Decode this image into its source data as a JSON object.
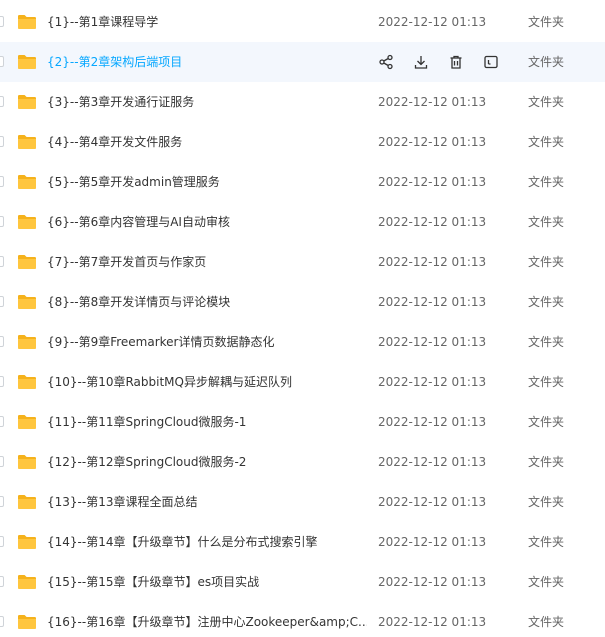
{
  "files": [
    {
      "name": "{1}--第1章课程导学",
      "date": "2022-12-12 01:13",
      "type": "文件夹"
    },
    {
      "name": "{2}--第2章架构后端项目",
      "date": "2022-12-12 01:13",
      "type": "文件夹",
      "hovered": true
    },
    {
      "name": "{3}--第3章开发通行证服务",
      "date": "2022-12-12 01:13",
      "type": "文件夹"
    },
    {
      "name": "{4}--第4章开发文件服务",
      "date": "2022-12-12 01:13",
      "type": "文件夹"
    },
    {
      "name": "{5}--第5章开发admin管理服务",
      "date": "2022-12-12 01:13",
      "type": "文件夹"
    },
    {
      "name": "{6}--第6章内容管理与AI自动审核",
      "date": "2022-12-12 01:13",
      "type": "文件夹"
    },
    {
      "name": "{7}--第7章开发首页与作家页",
      "date": "2022-12-12 01:13",
      "type": "文件夹"
    },
    {
      "name": "{8}--第8章开发详情页与评论模块",
      "date": "2022-12-12 01:13",
      "type": "文件夹"
    },
    {
      "name": "{9}--第9章Freemarker详情页数据静态化",
      "date": "2022-12-12 01:13",
      "type": "文件夹"
    },
    {
      "name": "{10}--第10章RabbitMQ异步解耦与延迟队列",
      "date": "2022-12-12 01:13",
      "type": "文件夹"
    },
    {
      "name": "{11}--第11章SpringCloud微服务-1",
      "date": "2022-12-12 01:13",
      "type": "文件夹"
    },
    {
      "name": "{12}--第12章SpringCloud微服务-2",
      "date": "2022-12-12 01:13",
      "type": "文件夹"
    },
    {
      "name": "{13}--第13章课程全面总结",
      "date": "2022-12-12 01:13",
      "type": "文件夹"
    },
    {
      "name": "{14}--第14章【升级章节】什么是分布式搜索引擎",
      "date": "2022-12-12 01:13",
      "type": "文件夹"
    },
    {
      "name": "{15}--第15章【升级章节】es项目实战",
      "date": "2022-12-12 01:13",
      "type": "文件夹"
    },
    {
      "name": "{16}--第16章【升级章节】注册中心Zookeeper&amp;C...",
      "date": "2022-12-12 01:13",
      "type": "文件夹"
    }
  ],
  "row_actions": [
    "share-icon",
    "download-icon",
    "delete-icon",
    "more-icon"
  ],
  "colors": {
    "folder": "#ffc63f",
    "folder_dark": "#f5b21c",
    "hover_background": "#f3f7fd",
    "hover_text": "#06a7ff",
    "action_icon": "#333333"
  }
}
